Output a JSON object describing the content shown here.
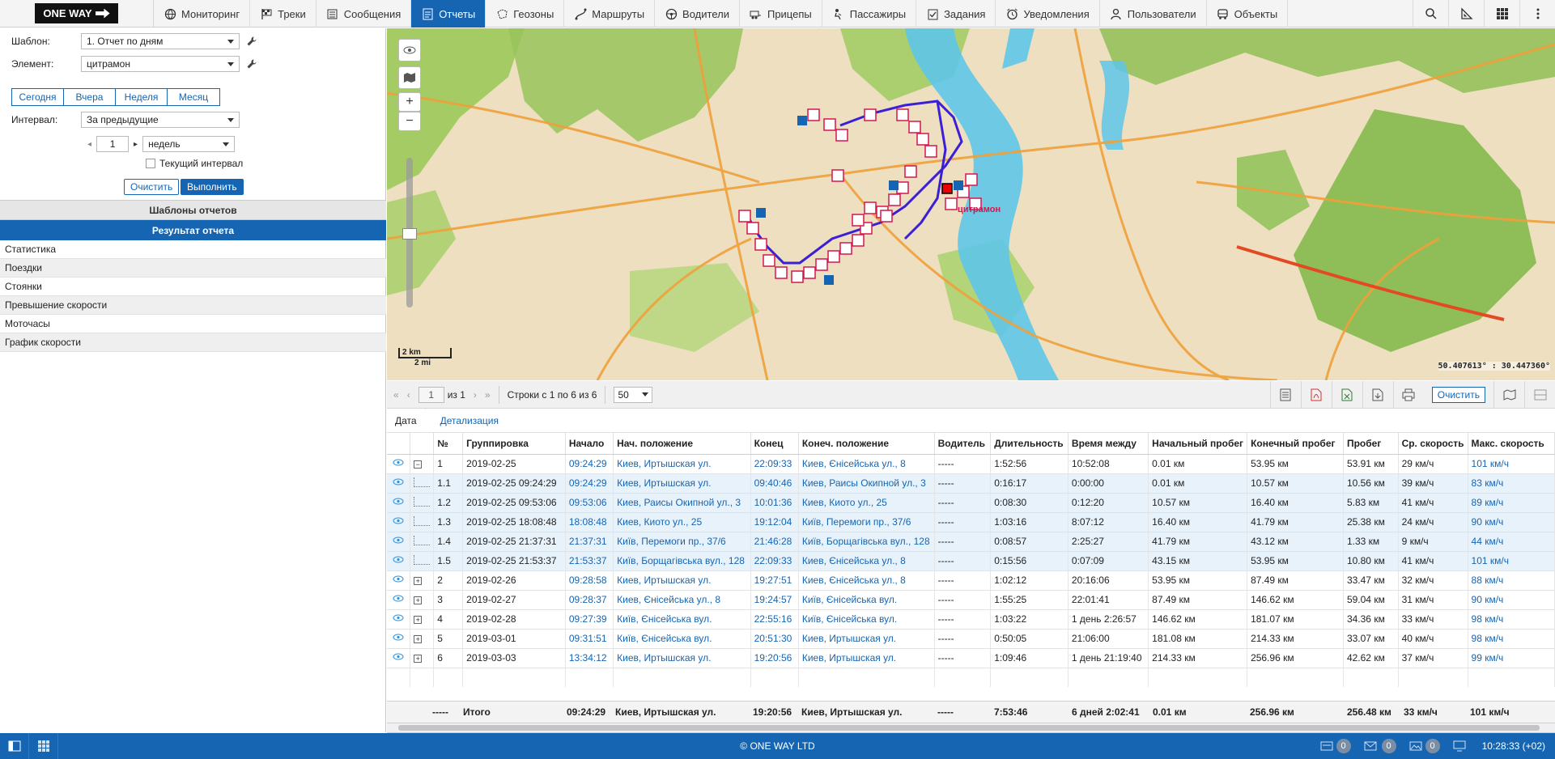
{
  "brand": {
    "logo_text": "ONE WAY"
  },
  "nav": {
    "items": [
      {
        "label": "Мониторинг",
        "icon": "globe-icon"
      },
      {
        "label": "Треки",
        "icon": "checkered-flag-icon"
      },
      {
        "label": "Сообщения",
        "icon": "list-icon"
      },
      {
        "label": "Отчеты",
        "icon": "report-icon",
        "active": true
      },
      {
        "label": "Геозоны",
        "icon": "geozone-icon"
      },
      {
        "label": "Маршруты",
        "icon": "route-icon"
      },
      {
        "label": "Водители",
        "icon": "steering-wheel-icon"
      },
      {
        "label": "Прицепы",
        "icon": "trailer-icon"
      },
      {
        "label": "Пассажиры",
        "icon": "passenger-icon"
      },
      {
        "label": "Задания",
        "icon": "task-icon"
      },
      {
        "label": "Уведомления",
        "icon": "alarm-clock-icon"
      },
      {
        "label": "Пользователи",
        "icon": "user-icon"
      },
      {
        "label": "Объекты",
        "icon": "vehicle-icon"
      }
    ]
  },
  "report_form": {
    "template_label": "Шаблон:",
    "template_value": "1. Отчет по дням",
    "element_label": "Элемент:",
    "element_value": "цитрамон",
    "period_tabs": [
      "Сегодня",
      "Вчера",
      "Неделя",
      "Месяц"
    ],
    "interval_label": "Интервал:",
    "interval_value": "За предыдущие",
    "interval_count": "1",
    "interval_unit": "недель",
    "current_interval_label": "Текущий интервал",
    "clear_label": "Очистить",
    "run_label": "Выполнить"
  },
  "sections": {
    "templates": "Шаблоны отчетов",
    "result": "Результат отчета",
    "result_items": [
      "Статистика",
      "Поездки",
      "Стоянки",
      "Превышение скорости",
      "Моточасы",
      "График скорости"
    ]
  },
  "map": {
    "unit_label": "цитрамон",
    "scale_km": "2 km",
    "scale_mi": "2 mi",
    "coordinates": "50.407613° : 30.447360°"
  },
  "table_toolbar": {
    "page": "1",
    "of_label": "из 1",
    "rows_label": "Строки с 1 по 6 из 6",
    "per_page": "50",
    "clear_label": "Очистить"
  },
  "breadcrumb": {
    "first": "Дата",
    "second": "Детализация"
  },
  "table": {
    "columns": [
      "№",
      "Группировка",
      "Начало",
      "Нач. положение",
      "Конец",
      "Конеч. положение",
      "Водитель",
      "Длительность",
      "Время между",
      "Начальный пробег",
      "Конечный пробег",
      "Пробег",
      "Ср. скорость",
      "Макс. скорость"
    ],
    "rows": [
      {
        "sub": false,
        "exp": "−",
        "n": "1",
        "group": "2019-02-25",
        "start": "09:24:29",
        "start_loc": "Киев, Иртышская ул.",
        "end": "22:09:33",
        "end_loc": "Киев, Єнісейська ул., 8",
        "driver": "-----",
        "dur": "1:52:56",
        "between": "10:52:08",
        "odo_start": "0.01 км",
        "odo_end": "53.95 км",
        "dist": "53.91 км",
        "avg": "29 км/ч",
        "max": "101 км/ч"
      },
      {
        "sub": true,
        "n": "1.1",
        "group": "2019-02-25 09:24:29",
        "start": "09:24:29",
        "start_loc": "Киев, Иртышская ул.",
        "end": "09:40:46",
        "end_loc": "Киев, Раисы Окипной ул., 3",
        "driver": "-----",
        "dur": "0:16:17",
        "between": "0:00:00",
        "odo_start": "0.01 км",
        "odo_end": "10.57 км",
        "dist": "10.56 км",
        "avg": "39 км/ч",
        "max": "83 км/ч"
      },
      {
        "sub": true,
        "n": "1.2",
        "group": "2019-02-25 09:53:06",
        "start": "09:53:06",
        "start_loc": "Киев, Раисы Окипной ул., 3",
        "end": "10:01:36",
        "end_loc": "Киев, Киото ул., 25",
        "driver": "-----",
        "dur": "0:08:30",
        "between": "0:12:20",
        "odo_start": "10.57 км",
        "odo_end": "16.40 км",
        "dist": "5.83 км",
        "avg": "41 км/ч",
        "max": "89 км/ч"
      },
      {
        "sub": true,
        "n": "1.3",
        "group": "2019-02-25 18:08:48",
        "start": "18:08:48",
        "start_loc": "Киев, Киото ул., 25",
        "end": "19:12:04",
        "end_loc": "Київ, Перемоги пр., 37/6",
        "driver": "-----",
        "dur": "1:03:16",
        "between": "8:07:12",
        "odo_start": "16.40 км",
        "odo_end": "41.79 км",
        "dist": "25.38 км",
        "avg": "24 км/ч",
        "max": "90 км/ч"
      },
      {
        "sub": true,
        "n": "1.4",
        "group": "2019-02-25 21:37:31",
        "start": "21:37:31",
        "start_loc": "Київ, Перемоги пр., 37/6",
        "end": "21:46:28",
        "end_loc": "Київ, Борщагівська вул., 128",
        "driver": "-----",
        "dur": "0:08:57",
        "between": "2:25:27",
        "odo_start": "41.79 км",
        "odo_end": "43.12 км",
        "dist": "1.33 км",
        "avg": "9 км/ч",
        "max": "44 км/ч"
      },
      {
        "sub": true,
        "n": "1.5",
        "group": "2019-02-25 21:53:37",
        "start": "21:53:37",
        "start_loc": "Київ, Борщагівська вул., 128",
        "end": "22:09:33",
        "end_loc": "Киев, Єнісейська ул., 8",
        "driver": "-----",
        "dur": "0:15:56",
        "between": "0:07:09",
        "odo_start": "43.15 км",
        "odo_end": "53.95 км",
        "dist": "10.80 км",
        "avg": "41 км/ч",
        "max": "101 км/ч"
      },
      {
        "sub": false,
        "exp": "+",
        "n": "2",
        "group": "2019-02-26",
        "start": "09:28:58",
        "start_loc": "Киев, Иртышская ул.",
        "end": "19:27:51",
        "end_loc": "Киев, Єнісейська ул., 8",
        "driver": "-----",
        "dur": "1:02:12",
        "between": "20:16:06",
        "odo_start": "53.95 км",
        "odo_end": "87.49 км",
        "dist": "33.47 км",
        "avg": "32 км/ч",
        "max": "88 км/ч"
      },
      {
        "sub": false,
        "exp": "+",
        "n": "3",
        "group": "2019-02-27",
        "start": "09:28:37",
        "start_loc": "Киев, Єнісейська ул., 8",
        "end": "19:24:57",
        "end_loc": "Київ, Єнісейська вул.",
        "driver": "-----",
        "dur": "1:55:25",
        "between": "22:01:41",
        "odo_start": "87.49 км",
        "odo_end": "146.62 км",
        "dist": "59.04 км",
        "avg": "31 км/ч",
        "max": "90 км/ч"
      },
      {
        "sub": false,
        "exp": "+",
        "n": "4",
        "group": "2019-02-28",
        "start": "09:27:39",
        "start_loc": "Київ, Єнісейська вул.",
        "end": "22:55:16",
        "end_loc": "Київ, Єнісейська вул.",
        "driver": "-----",
        "dur": "1:03:22",
        "between": "1 день 2:26:57",
        "odo_start": "146.62 км",
        "odo_end": "181.07 км",
        "dist": "34.36 км",
        "avg": "33 км/ч",
        "max": "98 км/ч"
      },
      {
        "sub": false,
        "exp": "+",
        "n": "5",
        "group": "2019-03-01",
        "start": "09:31:51",
        "start_loc": "Київ, Єнісейська вул.",
        "end": "20:51:30",
        "end_loc": "Киев, Иртышская ул.",
        "driver": "-----",
        "dur": "0:50:05",
        "between": "21:06:00",
        "odo_start": "181.08 км",
        "odo_end": "214.33 км",
        "dist": "33.07 км",
        "avg": "40 км/ч",
        "max": "98 км/ч"
      },
      {
        "sub": false,
        "exp": "+",
        "n": "6",
        "group": "2019-03-03",
        "start": "13:34:12",
        "start_loc": "Киев, Иртышская ул.",
        "end": "19:20:56",
        "end_loc": "Киев, Иртышская ул.",
        "driver": "-----",
        "dur": "1:09:46",
        "between": "1 день 21:19:40",
        "odo_start": "214.33 км",
        "odo_end": "256.96 км",
        "dist": "42.62 км",
        "avg": "37 км/ч",
        "max": "99 км/ч"
      }
    ],
    "totals": {
      "n": "-----",
      "group": "Итого",
      "start": "09:24:29",
      "start_loc": "Киев, Иртышская ул.",
      "end": "19:20:56",
      "end_loc": "Киев, Иртышская ул.",
      "driver": "-----",
      "dur": "7:53:46",
      "between": "6 дней 2:02:41",
      "odo_start": "0.01 км",
      "odo_end": "256.96 км",
      "dist": "256.48 км",
      "avg": "33 км/ч",
      "max": "101 км/ч"
    }
  },
  "status_bar": {
    "copyright": "© ONE WAY LTD",
    "counters": [
      "0",
      "0",
      "0"
    ],
    "time": "10:28:33 (+02)"
  },
  "colors": {
    "accent": "#1565b3",
    "link": "#1565b3",
    "sub_row": "#e8f2fb"
  }
}
